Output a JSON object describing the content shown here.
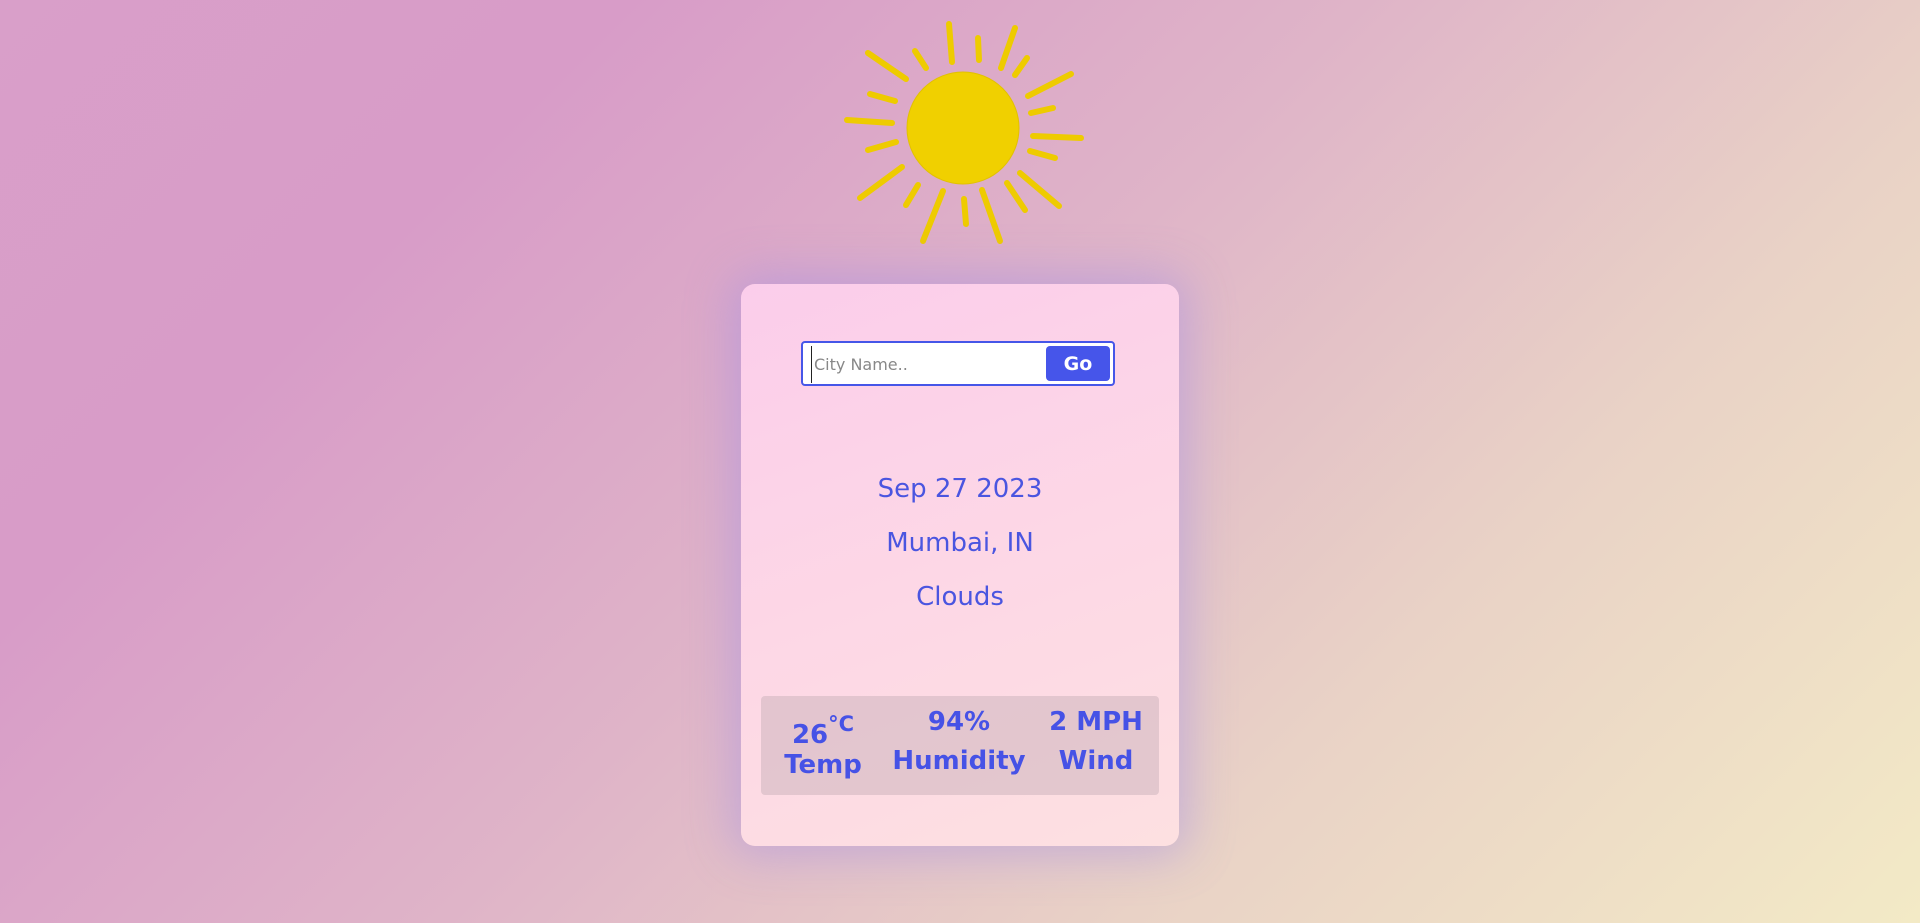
{
  "search": {
    "placeholder": "City Name..",
    "button_label": "Go"
  },
  "weather": {
    "date": "Sep 27 2023",
    "location": "Mumbai, IN",
    "condition": "Clouds",
    "icon": "sun-icon"
  },
  "stats": {
    "temp_value": "26",
    "temp_unit": "°C",
    "temp_label": "Temp",
    "humidity_value": "94%",
    "humidity_label": "Humidity",
    "wind_value": "2 MPH",
    "wind_label": "Wind"
  },
  "colors": {
    "accent": "#4655ea",
    "sun": "#f0d000"
  }
}
